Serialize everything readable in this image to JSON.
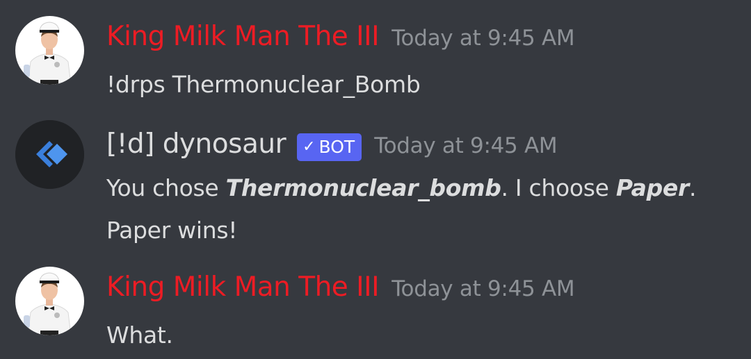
{
  "messages": [
    {
      "author": "King Milk Man The III",
      "author_color": "#ed1c24",
      "timestamp": "Today at 9:45 AM",
      "text": "!drps Thermonuclear_Bomb",
      "avatar_icon": "milkman-avatar"
    },
    {
      "author": "[!d] dynosaur",
      "author_color": "#dcddde",
      "timestamp": "Today at 9:45 AM",
      "bot_tag": "BOT",
      "bot_check": "✓",
      "avatar_icon": "dyno-logo-avatar",
      "line1": {
        "part1": "You chose ",
        "bold1": "Thermonuclear_bomb",
        "part2": ". I choose ",
        "bold2": "Paper",
        "part3": "."
      },
      "line2": "Paper wins!"
    },
    {
      "author": "King Milk Man The III",
      "author_color": "#ed1c24",
      "timestamp": "Today at 9:45 AM",
      "text": "What.",
      "avatar_icon": "milkman-avatar"
    }
  ],
  "colors": {
    "background": "#36393f",
    "timestamp": "#8e9297",
    "text": "#dcddde",
    "bot_tag": "#5865f2"
  }
}
